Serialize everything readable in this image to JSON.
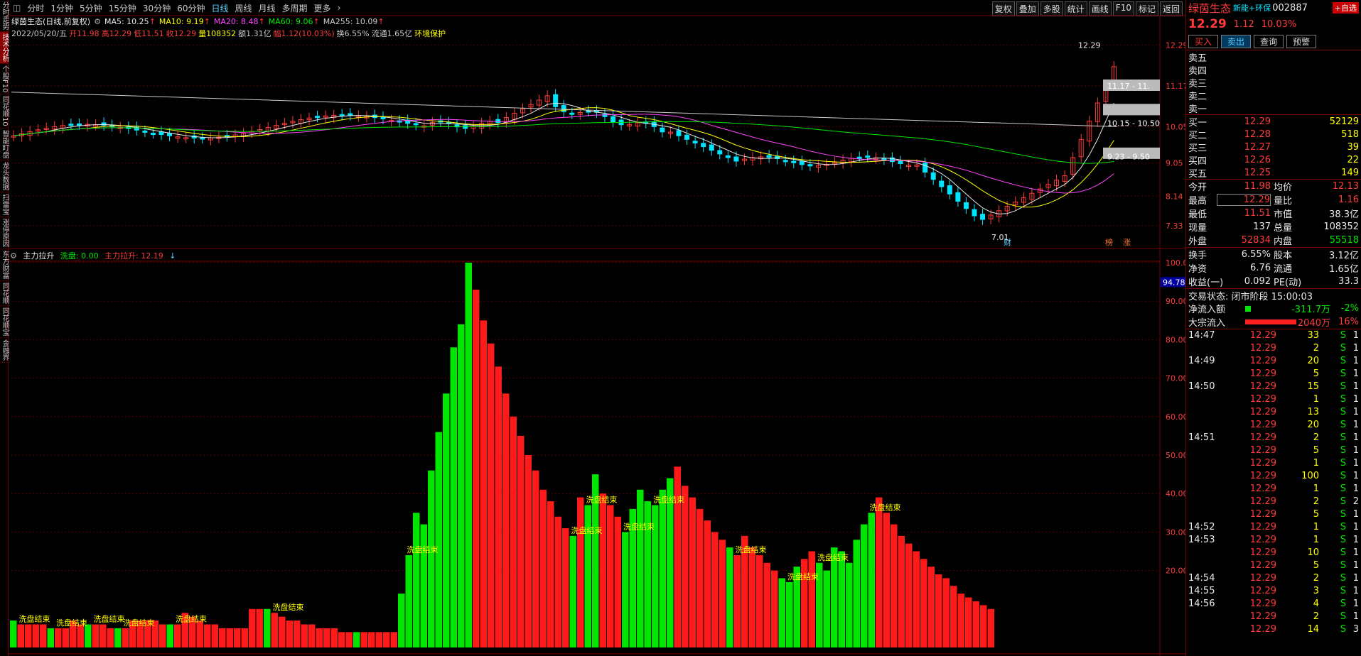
{
  "tabs_left": [
    "分时走势",
    "技术分析",
    "个股F10",
    "同花顺10",
    "智能盯盘",
    "龙头数据",
    "扫雷宝",
    "涨停原因",
    "东方财富",
    "同花顺",
    "同花顺宝",
    "金融界"
  ],
  "periods": [
    "分时",
    "1分钟",
    "5分钟",
    "15分钟",
    "30分钟",
    "60分钟",
    "日线",
    "周线",
    "月线",
    "多周期",
    "更多"
  ],
  "period_active": 6,
  "tools": [
    "复权",
    "叠加",
    "多股",
    "统计",
    "画线",
    "F10",
    "标记",
    "返回"
  ],
  "kline": {
    "title": "绿茵生态(日线,前复权)",
    "ma": [
      {
        "label": "MA5: 10.25",
        "color": "#e8e8e8"
      },
      {
        "label": "MA10: 9.19",
        "color": "#ffff00"
      },
      {
        "label": "MA20: 8.48",
        "color": "#ff44ff"
      },
      {
        "label": "MA60: 9.06",
        "color": "#00e600"
      },
      {
        "label": "MA255: 10.09",
        "color": "#cccccc"
      }
    ],
    "info": [
      {
        "t": "2022/05/20/五",
        "c": "#c8c8c8"
      },
      {
        "t": "开11.98",
        "c": "#ff3b3b"
      },
      {
        "t": "高12.29",
        "c": "#ff3b3b"
      },
      {
        "t": "低11.51",
        "c": "#ff3b3b"
      },
      {
        "t": "收12.29",
        "c": "#ff3b3b"
      },
      {
        "t": "量108352",
        "c": "#ffff00"
      },
      {
        "t": "额1.31亿",
        "c": "#c8c8c8"
      },
      {
        "t": "幅1.12(10.03%)",
        "c": "#ff3b3b"
      },
      {
        "t": "换6.55%",
        "c": "#c8c8c8"
      },
      {
        "t": "流通1.65亿",
        "c": "#c8c8c8"
      },
      {
        "t": "环境保护",
        "c": "#ffff00"
      }
    ],
    "yticks": [
      "12.29",
      "11.17",
      "10.05",
      "9.05",
      "8.14",
      "7.33"
    ],
    "high_label": "12.29",
    "low_label": "7.01",
    "box_labels": [
      "11.17 - 11.",
      "10.15 - 10.50",
      "9.23 - 9.50"
    ],
    "bottom_tags": [
      "财",
      "榜",
      "涨"
    ]
  },
  "indicator": {
    "name": "主力拉升",
    "wash_label": "洗盘: 0.00",
    "pull_label": "主力拉升: 12.19",
    "yticks": [
      "100.0",
      "90.00",
      "80.00",
      "70.00",
      "60.00",
      "50.00",
      "40.00",
      "30.00",
      "20.00"
    ],
    "current": "94.78",
    "annot": "洗盘结束"
  },
  "chart_data": {
    "type": "bar",
    "title": "主力拉升",
    "ylim": [
      0,
      100
    ],
    "values": [
      7,
      6,
      6,
      6,
      6,
      5,
      5,
      5,
      7,
      6,
      6,
      6,
      6,
      5,
      5,
      5,
      7,
      7,
      7,
      7,
      6,
      6,
      6,
      9,
      8,
      7,
      6,
      6,
      5,
      5,
      5,
      5,
      10,
      10,
      10,
      9,
      8,
      7,
      7,
      6,
      6,
      5,
      5,
      5,
      4,
      4,
      4,
      4,
      4,
      4,
      4,
      4,
      14,
      24,
      35,
      32,
      46,
      56,
      66,
      78,
      84,
      100,
      93,
      85,
      79,
      73,
      66,
      60,
      55,
      50,
      46,
      41,
      38,
      34,
      31,
      29,
      39,
      37,
      45,
      40,
      37,
      34,
      30,
      36,
      41,
      38,
      37,
      41,
      44,
      47,
      42,
      39,
      36,
      33,
      30,
      28,
      26,
      24,
      29,
      26,
      24,
      22,
      20,
      18,
      17,
      21,
      23,
      25,
      22,
      20,
      26,
      25,
      22,
      28,
      32,
      35,
      39,
      35,
      32,
      29,
      27,
      25,
      23,
      21,
      19,
      18,
      16,
      14,
      13,
      12,
      11,
      10
    ],
    "green_index": [
      0,
      5,
      10,
      14,
      21,
      34,
      46,
      52,
      53,
      54,
      55,
      56,
      57,
      58,
      59,
      60,
      61,
      75,
      77,
      78,
      82,
      83,
      84,
      85,
      86,
      87,
      88,
      96,
      103,
      104,
      105,
      108,
      109,
      110,
      111,
      112,
      113,
      114,
      115
    ],
    "annot_index": [
      1,
      6,
      11,
      15,
      22,
      35,
      53,
      75,
      77,
      82,
      86,
      97,
      104,
      108,
      115
    ]
  },
  "quote": {
    "name": "绿茵生态",
    "sector": "新能+环保",
    "code": "002887",
    "add_label": "+自选",
    "price": "12.29",
    "change": "1.12",
    "pct": "10.03%",
    "buttons": [
      "买入",
      "卖出",
      "查询",
      "预警"
    ],
    "sells": [
      "卖五",
      "卖四",
      "卖三",
      "卖二",
      "卖一"
    ],
    "buys": [
      {
        "l": "买一",
        "p": "12.29",
        "v": "52129"
      },
      {
        "l": "买二",
        "p": "12.28",
        "v": "518"
      },
      {
        "l": "买三",
        "p": "12.27",
        "v": "39"
      },
      {
        "l": "买四",
        "p": "12.26",
        "v": "22"
      },
      {
        "l": "买五",
        "p": "12.25",
        "v": "149"
      }
    ],
    "stats": [
      {
        "a": "今开",
        "av": "11.98",
        "ac": "red",
        "b": "均价",
        "bv": "12.13",
        "bc": "red"
      },
      {
        "a": "最高",
        "av": "12.29",
        "ac": "red",
        "b": "量比",
        "bv": "1.16",
        "bc": "red"
      },
      {
        "a": "最低",
        "av": "11.51",
        "ac": "red",
        "b": "市值",
        "bv": "38.3亿",
        "bc": "white"
      },
      {
        "a": "现量",
        "av": "137",
        "ac": "white",
        "b": "总量",
        "bv": "108352",
        "bc": "white"
      },
      {
        "a": "外盘",
        "av": "52834",
        "ac": "red",
        "b": "内盘",
        "bv": "55518",
        "bc": "green"
      }
    ],
    "stats2": [
      {
        "a": "换手",
        "av": "6.55%",
        "b": "股本",
        "bv": "3.12亿"
      },
      {
        "a": "净资",
        "av": "6.76",
        "b": "流通",
        "bv": "1.65亿"
      },
      {
        "a": "收益(一)",
        "av": "0.092",
        "b": "PE(动)",
        "bv": "33.3"
      }
    ],
    "status": "交易状态: 闭市阶段 15:00:03",
    "netflow": {
      "label": "净流入额",
      "value": "-311.7万",
      "pct": "-2%"
    },
    "bigflow": {
      "label": "大宗流入",
      "value": "2040万",
      "pct": "16%"
    },
    "trades": [
      {
        "t": "14:47",
        "p": "12.29",
        "v": "33",
        "s": "S",
        "c": "1"
      },
      {
        "t": "",
        "p": "12.29",
        "v": "2",
        "s": "S",
        "c": "1"
      },
      {
        "t": "14:49",
        "p": "12.29",
        "v": "20",
        "s": "S",
        "c": "1"
      },
      {
        "t": "",
        "p": "12.29",
        "v": "5",
        "s": "S",
        "c": "1"
      },
      {
        "t": "14:50",
        "p": "12.29",
        "v": "15",
        "s": "S",
        "c": "1"
      },
      {
        "t": "",
        "p": "12.29",
        "v": "1",
        "s": "S",
        "c": "1"
      },
      {
        "t": "",
        "p": "12.29",
        "v": "13",
        "s": "S",
        "c": "1"
      },
      {
        "t": "",
        "p": "12.29",
        "v": "20",
        "s": "S",
        "c": "1"
      },
      {
        "t": "14:51",
        "p": "12.29",
        "v": "2",
        "s": "S",
        "c": "1"
      },
      {
        "t": "",
        "p": "12.29",
        "v": "5",
        "s": "S",
        "c": "1"
      },
      {
        "t": "",
        "p": "12.29",
        "v": "1",
        "s": "S",
        "c": "1"
      },
      {
        "t": "",
        "p": "12.29",
        "v": "100",
        "s": "S",
        "c": "1"
      },
      {
        "t": "",
        "p": "12.29",
        "v": "1",
        "s": "S",
        "c": "1"
      },
      {
        "t": "",
        "p": "12.29",
        "v": "2",
        "s": "S",
        "c": "2"
      },
      {
        "t": "",
        "p": "12.29",
        "v": "5",
        "s": "S",
        "c": "1"
      },
      {
        "t": "14:52",
        "p": "12.29",
        "v": "1",
        "s": "S",
        "c": "1"
      },
      {
        "t": "14:53",
        "p": "12.29",
        "v": "1",
        "s": "S",
        "c": "1"
      },
      {
        "t": "",
        "p": "12.29",
        "v": "10",
        "s": "S",
        "c": "1"
      },
      {
        "t": "",
        "p": "12.29",
        "v": "5",
        "s": "S",
        "c": "1"
      },
      {
        "t": "14:54",
        "p": "12.29",
        "v": "2",
        "s": "S",
        "c": "1"
      },
      {
        "t": "14:55",
        "p": "12.29",
        "v": "3",
        "s": "S",
        "c": "1"
      },
      {
        "t": "14:56",
        "p": "12.29",
        "v": "4",
        "s": "S",
        "c": "1"
      },
      {
        "t": "",
        "p": "12.29",
        "v": "2",
        "s": "S",
        "c": "1"
      },
      {
        "t": "",
        "p": "12.29",
        "v": "14",
        "s": "S",
        "c": "3"
      }
    ]
  }
}
